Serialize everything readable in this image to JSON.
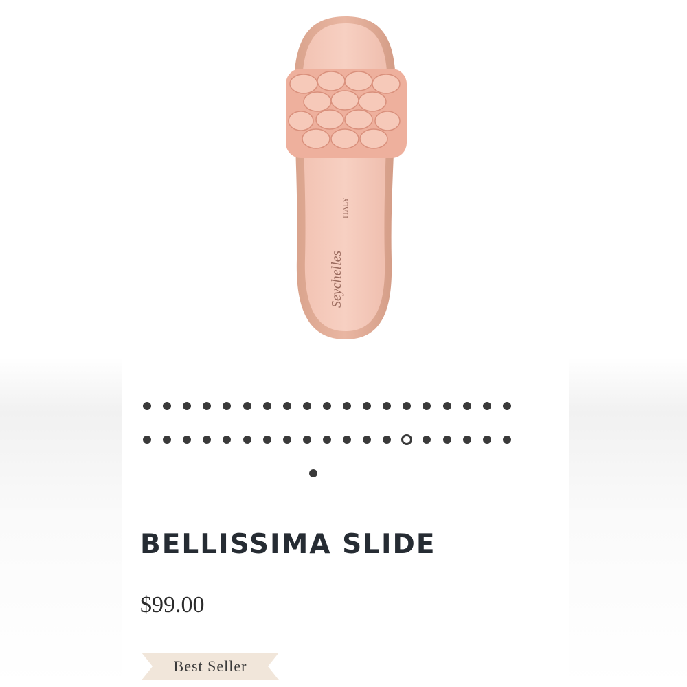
{
  "product": {
    "name": "BELLISSIMA SLIDE",
    "price": "$99.00",
    "badge": "Best Seller",
    "image_alt": "pink woven slide sandal",
    "insole_print": {
      "brand": "Seychelles",
      "origin": "ITALY"
    },
    "color": "#f0b9a8"
  },
  "carousel": {
    "total_slides": 39,
    "active_index": 32
  }
}
